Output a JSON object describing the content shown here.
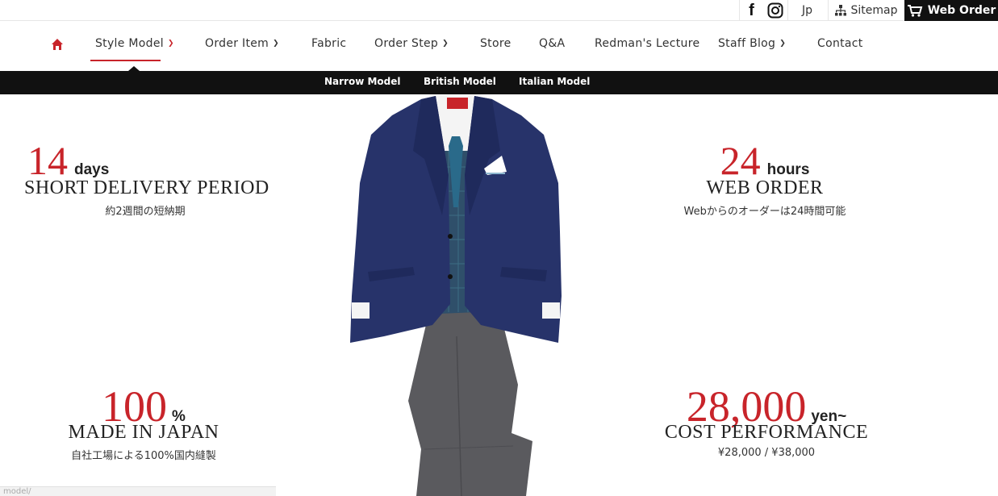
{
  "topbar": {
    "facebook_icon": "facebook-icon",
    "instagram_icon": "instagram-icon",
    "language": "Jp",
    "sitemap": "Sitemap",
    "web_order": "Web Order"
  },
  "nav": {
    "home_icon": "home-icon",
    "items": [
      {
        "label": "Style Model",
        "dropdown": true
      },
      {
        "label": "Order Item",
        "dropdown": true
      },
      {
        "label": "Fabric",
        "dropdown": false
      },
      {
        "label": "Order Step",
        "dropdown": true
      },
      {
        "label": "Store",
        "dropdown": false
      },
      {
        "label": "Q&A",
        "dropdown": false
      },
      {
        "label": "Redman's Lecture",
        "dropdown": false
      },
      {
        "label": "Staff Blog",
        "dropdown": true
      },
      {
        "label": "Contact",
        "dropdown": false
      }
    ],
    "active": "Style Model",
    "accent_color": "#c8242a"
  },
  "subnav": {
    "items": [
      "Narrow Model",
      "British Model",
      "Italian Model"
    ]
  },
  "hero": {
    "stats": [
      {
        "number": "14",
        "unit": "days",
        "title": "SHORT DELIVERY PERIOD",
        "subtitle": "約2週間の短納期"
      },
      {
        "number": "24",
        "unit": "hours",
        "title": "WEB ORDER",
        "subtitle": "Webからのオーダーは24時間可能"
      },
      {
        "number": "100",
        "unit": "%",
        "title": "MADE IN JAPAN",
        "subtitle": "自社工場による100%国内縫製"
      },
      {
        "number": "28,000",
        "unit": "yen~",
        "title": "COST PERFORMANCE",
        "subtitle": "¥28,000 / ¥38,000"
      }
    ]
  },
  "status_url": "model/"
}
